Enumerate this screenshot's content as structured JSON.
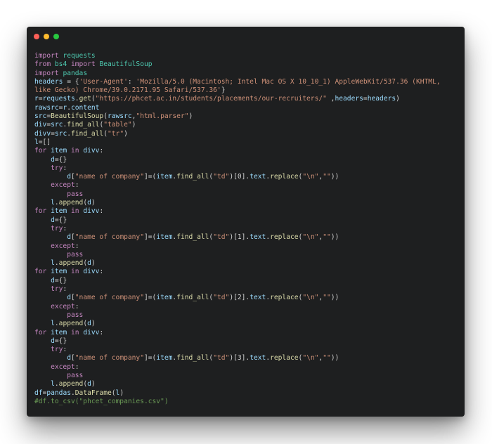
{
  "window": {
    "controls": {
      "close_color": "#fc5f57",
      "minimize_color": "#fdbc2e",
      "maximize_color": "#28c840"
    }
  },
  "theme": {
    "background": "#1e1f20",
    "keyword": "#c586c0",
    "module": "#4ec9b0",
    "variable": "#9cdcfe",
    "string": "#ce9178",
    "function": "#dcdcaa",
    "comment": "#6a9955",
    "text": "#d4d4d4"
  },
  "code": {
    "language": "python",
    "lines": [
      [
        [
          "kw",
          "import"
        ],
        [
          "pl",
          " "
        ],
        [
          "mod",
          "requests"
        ]
      ],
      [
        [
          "kw",
          "from"
        ],
        [
          "pl",
          " "
        ],
        [
          "mod",
          "bs4"
        ],
        [
          "pl",
          " "
        ],
        [
          "kw",
          "import"
        ],
        [
          "pl",
          " "
        ],
        [
          "mod",
          "BeautifulSoup"
        ]
      ],
      [
        [
          "kw",
          "import"
        ],
        [
          "pl",
          " "
        ],
        [
          "mod",
          "pandas"
        ]
      ],
      [
        [
          "var",
          "headers"
        ],
        [
          "pl",
          " = {"
        ],
        [
          "str",
          "'User-Agent'"
        ],
        [
          "pl",
          ": "
        ],
        [
          "str",
          "'Mozilla/5.0 (Macintosh; Intel Mac OS X 10_10_1) AppleWebKit/537.36 (KHTML,"
        ]
      ],
      [
        [
          "str",
          "like Gecko) Chrome/39.0.2171.95 Safari/537.36'"
        ],
        [
          "pl",
          "}"
        ]
      ],
      [
        [
          "var",
          "r"
        ],
        [
          "pl",
          "="
        ],
        [
          "var",
          "requests"
        ],
        [
          "pl",
          "."
        ],
        [
          "fn",
          "get"
        ],
        [
          "pl",
          "("
        ],
        [
          "str",
          "\"https://phcet.ac.in/students/placements/our-recruiters/\""
        ],
        [
          "pl",
          " ,"
        ],
        [
          "var",
          "headers"
        ],
        [
          "pl",
          "="
        ],
        [
          "var",
          "headers"
        ],
        [
          "pl",
          ")"
        ]
      ],
      [
        [
          "var",
          "rawsrc"
        ],
        [
          "pl",
          "="
        ],
        [
          "var",
          "r"
        ],
        [
          "pl",
          "."
        ],
        [
          "var",
          "content"
        ]
      ],
      [
        [
          "var",
          "src"
        ],
        [
          "pl",
          "="
        ],
        [
          "fn",
          "BeautifulSoup"
        ],
        [
          "pl",
          "("
        ],
        [
          "var",
          "rawsrc"
        ],
        [
          "pl",
          ","
        ],
        [
          "str",
          "\"html.parser\""
        ],
        [
          "pl",
          ")"
        ]
      ],
      [
        [
          "var",
          "div"
        ],
        [
          "pl",
          "="
        ],
        [
          "var",
          "src"
        ],
        [
          "pl",
          "."
        ],
        [
          "fn",
          "find_all"
        ],
        [
          "pl",
          "("
        ],
        [
          "str",
          "\"table\""
        ],
        [
          "pl",
          ")"
        ]
      ],
      [
        [
          "var",
          "divv"
        ],
        [
          "pl",
          "="
        ],
        [
          "var",
          "src"
        ],
        [
          "pl",
          "."
        ],
        [
          "fn",
          "find_all"
        ],
        [
          "pl",
          "("
        ],
        [
          "str",
          "\"tr\""
        ],
        [
          "pl",
          ")"
        ]
      ],
      [
        [
          "var",
          "l"
        ],
        [
          "pl",
          "=[]"
        ]
      ],
      [
        [
          "kw",
          "for"
        ],
        [
          "pl",
          " "
        ],
        [
          "var",
          "item"
        ],
        [
          "pl",
          " "
        ],
        [
          "kw",
          "in"
        ],
        [
          "pl",
          " "
        ],
        [
          "var",
          "divv"
        ],
        [
          "pl",
          ":"
        ]
      ],
      [
        [
          "pl",
          "    "
        ],
        [
          "var",
          "d"
        ],
        [
          "pl",
          "={}"
        ]
      ],
      [
        [
          "pl",
          "    "
        ],
        [
          "kw",
          "try"
        ],
        [
          "pl",
          ":"
        ]
      ],
      [
        [
          "pl",
          "        "
        ],
        [
          "var",
          "d"
        ],
        [
          "pl",
          "["
        ],
        [
          "str",
          "\"name of company\""
        ],
        [
          "pl",
          "]=("
        ],
        [
          "var",
          "item"
        ],
        [
          "pl",
          "."
        ],
        [
          "fn",
          "find_all"
        ],
        [
          "pl",
          "("
        ],
        [
          "str",
          "\"td\""
        ],
        [
          "pl",
          ")[0]."
        ],
        [
          "var",
          "text"
        ],
        [
          "pl",
          "."
        ],
        [
          "fn",
          "replace"
        ],
        [
          "pl",
          "("
        ],
        [
          "str",
          "\"\\n\""
        ],
        [
          "pl",
          ","
        ],
        [
          "str",
          "\"\""
        ],
        [
          "pl",
          "))"
        ]
      ],
      [
        [
          "pl",
          "    "
        ],
        [
          "kw",
          "except"
        ],
        [
          "pl",
          ":"
        ]
      ],
      [
        [
          "pl",
          "        "
        ],
        [
          "kw",
          "pass"
        ]
      ],
      [
        [
          "pl",
          "    "
        ],
        [
          "var",
          "l"
        ],
        [
          "pl",
          "."
        ],
        [
          "fn",
          "append"
        ],
        [
          "pl",
          "("
        ],
        [
          "var",
          "d"
        ],
        [
          "pl",
          ")"
        ]
      ],
      [
        [
          "kw",
          "for"
        ],
        [
          "pl",
          " "
        ],
        [
          "var",
          "item"
        ],
        [
          "pl",
          " "
        ],
        [
          "kw",
          "in"
        ],
        [
          "pl",
          " "
        ],
        [
          "var",
          "divv"
        ],
        [
          "pl",
          ":"
        ]
      ],
      [
        [
          "pl",
          "    "
        ],
        [
          "var",
          "d"
        ],
        [
          "pl",
          "={}"
        ]
      ],
      [
        [
          "pl",
          "    "
        ],
        [
          "kw",
          "try"
        ],
        [
          "pl",
          ":"
        ]
      ],
      [
        [
          "pl",
          "        "
        ],
        [
          "var",
          "d"
        ],
        [
          "pl",
          "["
        ],
        [
          "str",
          "\"name of company\""
        ],
        [
          "pl",
          "]=("
        ],
        [
          "var",
          "item"
        ],
        [
          "pl",
          "."
        ],
        [
          "fn",
          "find_all"
        ],
        [
          "pl",
          "("
        ],
        [
          "str",
          "\"td\""
        ],
        [
          "pl",
          ")[1]."
        ],
        [
          "var",
          "text"
        ],
        [
          "pl",
          "."
        ],
        [
          "fn",
          "replace"
        ],
        [
          "pl",
          "("
        ],
        [
          "str",
          "\"\\n\""
        ],
        [
          "pl",
          ","
        ],
        [
          "str",
          "\"\""
        ],
        [
          "pl",
          "))"
        ]
      ],
      [
        [
          "pl",
          "    "
        ],
        [
          "kw",
          "except"
        ],
        [
          "pl",
          ":"
        ]
      ],
      [
        [
          "pl",
          "        "
        ],
        [
          "kw",
          "pass"
        ]
      ],
      [
        [
          "pl",
          "    "
        ],
        [
          "var",
          "l"
        ],
        [
          "pl",
          "."
        ],
        [
          "fn",
          "append"
        ],
        [
          "pl",
          "("
        ],
        [
          "var",
          "d"
        ],
        [
          "pl",
          ")"
        ]
      ],
      [
        [
          "kw",
          "for"
        ],
        [
          "pl",
          " "
        ],
        [
          "var",
          "item"
        ],
        [
          "pl",
          " "
        ],
        [
          "kw",
          "in"
        ],
        [
          "pl",
          " "
        ],
        [
          "var",
          "divv"
        ],
        [
          "pl",
          ":"
        ]
      ],
      [
        [
          "pl",
          "    "
        ],
        [
          "var",
          "d"
        ],
        [
          "pl",
          "={}"
        ]
      ],
      [
        [
          "pl",
          "    "
        ],
        [
          "kw",
          "try"
        ],
        [
          "pl",
          ":"
        ]
      ],
      [
        [
          "pl",
          "        "
        ],
        [
          "var",
          "d"
        ],
        [
          "pl",
          "["
        ],
        [
          "str",
          "\"name of company\""
        ],
        [
          "pl",
          "]=("
        ],
        [
          "var",
          "item"
        ],
        [
          "pl",
          "."
        ],
        [
          "fn",
          "find_all"
        ],
        [
          "pl",
          "("
        ],
        [
          "str",
          "\"td\""
        ],
        [
          "pl",
          ")[2]."
        ],
        [
          "var",
          "text"
        ],
        [
          "pl",
          "."
        ],
        [
          "fn",
          "replace"
        ],
        [
          "pl",
          "("
        ],
        [
          "str",
          "\"\\n\""
        ],
        [
          "pl",
          ","
        ],
        [
          "str",
          "\"\""
        ],
        [
          "pl",
          "))"
        ]
      ],
      [
        [
          "pl",
          "    "
        ],
        [
          "kw",
          "except"
        ],
        [
          "pl",
          ":"
        ]
      ],
      [
        [
          "pl",
          "        "
        ],
        [
          "kw",
          "pass"
        ]
      ],
      [
        [
          "pl",
          "    "
        ],
        [
          "var",
          "l"
        ],
        [
          "pl",
          "."
        ],
        [
          "fn",
          "append"
        ],
        [
          "pl",
          "("
        ],
        [
          "var",
          "d"
        ],
        [
          "pl",
          ")"
        ]
      ],
      [
        [
          "kw",
          "for"
        ],
        [
          "pl",
          " "
        ],
        [
          "var",
          "item"
        ],
        [
          "pl",
          " "
        ],
        [
          "kw",
          "in"
        ],
        [
          "pl",
          " "
        ],
        [
          "var",
          "divv"
        ],
        [
          "pl",
          ":"
        ]
      ],
      [
        [
          "pl",
          "    "
        ],
        [
          "var",
          "d"
        ],
        [
          "pl",
          "={}"
        ]
      ],
      [
        [
          "pl",
          "    "
        ],
        [
          "kw",
          "try"
        ],
        [
          "pl",
          ":"
        ]
      ],
      [
        [
          "pl",
          "        "
        ],
        [
          "var",
          "d"
        ],
        [
          "pl",
          "["
        ],
        [
          "str",
          "\"name of company\""
        ],
        [
          "pl",
          "]=("
        ],
        [
          "var",
          "item"
        ],
        [
          "pl",
          "."
        ],
        [
          "fn",
          "find_all"
        ],
        [
          "pl",
          "("
        ],
        [
          "str",
          "\"td\""
        ],
        [
          "pl",
          ")[3]."
        ],
        [
          "var",
          "text"
        ],
        [
          "pl",
          "."
        ],
        [
          "fn",
          "replace"
        ],
        [
          "pl",
          "("
        ],
        [
          "str",
          "\"\\n\""
        ],
        [
          "pl",
          ","
        ],
        [
          "str",
          "\"\""
        ],
        [
          "pl",
          "))"
        ]
      ],
      [
        [
          "pl",
          "    "
        ],
        [
          "kw",
          "except"
        ],
        [
          "pl",
          ":"
        ]
      ],
      [
        [
          "pl",
          "        "
        ],
        [
          "kw",
          "pass"
        ]
      ],
      [
        [
          "pl",
          "    "
        ],
        [
          "var",
          "l"
        ],
        [
          "pl",
          "."
        ],
        [
          "fn",
          "append"
        ],
        [
          "pl",
          "("
        ],
        [
          "var",
          "d"
        ],
        [
          "pl",
          ")"
        ]
      ],
      [
        [
          "var",
          "df"
        ],
        [
          "pl",
          "="
        ],
        [
          "var",
          "pandas"
        ],
        [
          "pl",
          "."
        ],
        [
          "fn",
          "DataFrame"
        ],
        [
          "pl",
          "("
        ],
        [
          "var",
          "l"
        ],
        [
          "pl",
          ")"
        ]
      ],
      [
        [
          "cm",
          "#df.to_csv(\"phcet_companies.csv\")"
        ]
      ]
    ]
  }
}
